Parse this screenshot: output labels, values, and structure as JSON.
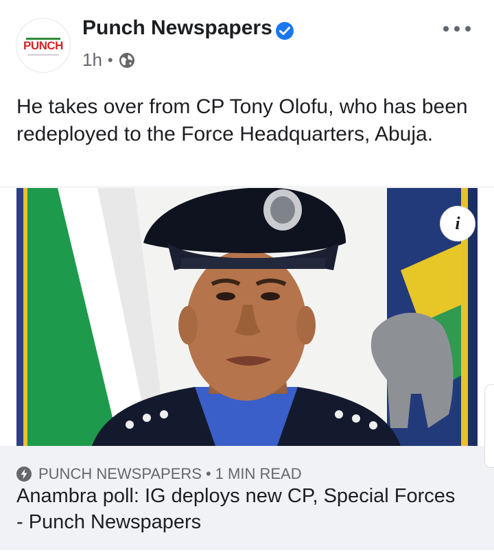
{
  "post": {
    "page_name": "Punch Newspapers",
    "avatar_text": "PUNCH",
    "time": "1h",
    "separator": "•",
    "caption": "He takes over from CP Tony Olofu, who has been redeployed to the Force Headquarters, Abuja."
  },
  "link": {
    "source": "PUNCH NEWSPAPERS",
    "separator": "•",
    "read_time": "1 MIN READ",
    "title": "Anambra poll: IG deploys new CP, Special Forces - Punch Newspapers"
  },
  "icons": {
    "verified": "verified-badge-icon",
    "audience": "globe-icon",
    "more": "more-options-icon",
    "info": "info-icon",
    "instant": "lightning-bolt-icon"
  },
  "colors": {
    "verified_blue": "#1877f2",
    "meta_gray": "#65676b",
    "footer_bg": "#f0f2f5",
    "brand_red": "#d2232a"
  }
}
